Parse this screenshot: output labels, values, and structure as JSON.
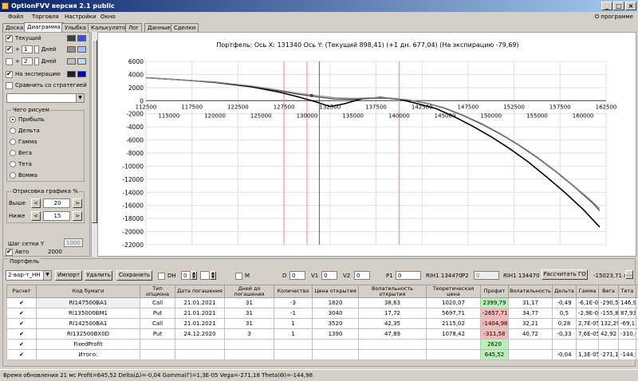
{
  "window": {
    "title": "OptionFVV версия 2.1 public"
  },
  "menu": {
    "items": [
      "Файл",
      "Торговля",
      "Настройки",
      "Окно"
    ],
    "about": "О программе"
  },
  "tabs": [
    "Доска",
    "Диаграмма",
    "Улыбка",
    "Калькулятор",
    "Лог",
    "Данные",
    "Сделки"
  ],
  "active_tab": "Диаграмма",
  "left": {
    "current_label": "Текущий",
    "plus": "+",
    "days_label": "Дней",
    "days1": "1",
    "days2": "2",
    "expiry_label": "На экспирацию",
    "compare_label": "Сравнить со стратегией",
    "what_title": "Чего рисуем",
    "radios": [
      "Прибыль",
      "Дельта",
      "Гамма",
      "Вега",
      "Тета",
      "Вомма"
    ],
    "render_title": "Отрисовка графика %",
    "above_label": "Выше",
    "above_value": "20",
    "below_label": "Ниже",
    "below_value": "15",
    "grid_step_label": "Шаг сетки Y",
    "grid_step_value": "1000",
    "auto_label": "Авто",
    "auto_value": "2000",
    "spin_left": "<",
    "spin_right": ">",
    "swatch_colors": [
      "#404040",
      "#3050ff",
      "#909090",
      "#a0c0ff",
      "#c0c0c0",
      "#c0d8ff",
      "#202020",
      "#0000cc"
    ]
  },
  "chart": {
    "header": "Портфель: Ось X: 131340 Ось Y:  (Текущий 898,41)  (+1 дн. 677,04)  (На экспирацию -79,69)"
  },
  "chart_data": {
    "type": "line",
    "ylim": [
      -22000,
      6000
    ],
    "yticks": [
      6000,
      4000,
      2000,
      0,
      -2000,
      -4000,
      -6000,
      -8000,
      -10000,
      -12000,
      -14000,
      -16000,
      -18000,
      -20000,
      -22000
    ],
    "xlim": [
      112500,
      162500
    ],
    "x_top_ticks": [
      112500,
      117500,
      122500,
      127500,
      132500,
      137500,
      142500,
      147500,
      152500,
      157500,
      162500
    ],
    "x_bottom_ticks": [
      115000,
      120000,
      125000,
      130000,
      135000,
      140000,
      145000,
      150000,
      155000,
      160000
    ],
    "cursor_x": 131340,
    "red_lines": [
      127500,
      130000,
      140000
    ],
    "marker": {
      "x": 130500,
      "y": 780
    },
    "grid": true,
    "series": [
      {
        "color": "#000000",
        "x": [
          112500,
          116000,
          120000,
          124000,
          127000,
          129000,
          131000,
          132500,
          134000,
          136000,
          138000,
          140000,
          142000,
          144000,
          146000,
          148000,
          150000,
          152000,
          154000,
          156000,
          158000,
          160000,
          161800
        ],
        "y": [
          3500,
          3200,
          2800,
          2100,
          1300,
          600,
          -200,
          -900,
          -500,
          300,
          500,
          220,
          -450,
          -1200,
          -2450,
          -3900,
          -5500,
          -7300,
          -9300,
          -11600,
          -14000,
          -16600,
          -19300
        ]
      },
      {
        "color": "#404040",
        "x": [
          112500,
          116000,
          120000,
          124000,
          127000,
          129000,
          131000,
          133000,
          135000,
          137000,
          139000,
          141000,
          143000,
          145000,
          147000,
          149000,
          151000,
          153000,
          155000,
          157000,
          159000,
          161000,
          161800
        ],
        "y": [
          3500,
          3200,
          2850,
          2200,
          1500,
          1000,
          600,
          250,
          200,
          350,
          350,
          100,
          -400,
          -1200,
          -2300,
          -3600,
          -5100,
          -6800,
          -8700,
          -10800,
          -13100,
          -15600,
          -16800
        ]
      },
      {
        "color": "#909090",
        "x": [
          112500,
          116000,
          120000,
          124000,
          127000,
          129000,
          131000,
          133000,
          135000,
          137000,
          139000,
          141000,
          143000,
          145000,
          147000,
          149000,
          151000,
          153000,
          155000,
          157000,
          159000,
          161000,
          161800
        ],
        "y": [
          3500,
          3200,
          2850,
          2250,
          1600,
          1150,
          800,
          450,
          350,
          450,
          420,
          150,
          -350,
          -1100,
          -2200,
          -3500,
          -5000,
          -6700,
          -8600,
          -10700,
          -13000,
          -15400,
          -16500
        ]
      }
    ]
  },
  "portfolio": {
    "title": "Портфель",
    "selector": "2-вар-т_НН",
    "import_btn": "Импорт",
    "delete_btn": "Удалить",
    "save_btn": "Сохранить",
    "dh_label": "DH",
    "dh_value": "0",
    "m_label": "M",
    "d_label": "D",
    "d_value": "0",
    "v1_label": "V1",
    "v1_value": "0",
    "v2_label": "V2",
    "v2_value": "0",
    "p1_label": "P1",
    "p1_value": "0",
    "rih1_a": "RIH1 134470",
    "p2_label": "P2",
    "p2_value": "0",
    "rih1_b": "RIH1 134470",
    "calc_btn": "Рассчитать ГО",
    "go_value": "-15023,71 п.",
    "go_btn": "...",
    "columns": [
      "Расчет",
      "Код бумаги",
      "Тип опциона",
      "Дата погашения",
      "Дней до погашения",
      "Количество",
      "Цена открытия",
      "Волатильность открытия",
      "Теоретическая цена",
      "Профит",
      "Волатильность",
      "Дельта",
      "Гамма",
      "Вега",
      "Тета",
      "✕"
    ],
    "rows": [
      [
        "✔",
        "RI147500BA1",
        "Call",
        "21.01.2021",
        "31",
        "-3",
        "1820",
        "38,63",
        "1020,07",
        "2399,79",
        "31,17",
        "-0,49",
        "-6,1E-05",
        "-290,51",
        "146,9",
        "✕"
      ],
      [
        "✔",
        "RI135000BM1",
        "Put",
        "21.01.2021",
        "31",
        "-1",
        "3040",
        "17,72",
        "5697,71",
        "-2657,71",
        "34,77",
        "0,5",
        "-2,9E-05",
        "-155,88",
        "87,93",
        "✕"
      ],
      [
        "✔",
        "RI142500BA1",
        "Call",
        "21.01.2021",
        "31",
        "1",
        "3520",
        "42,35",
        "2115,02",
        "-1404,98",
        "32,21",
        "0,28",
        "2,7E-05",
        "132,29",
        "-69,13",
        "✕"
      ],
      [
        "✔",
        "RI132500BX0D",
        "Put",
        "24.12.2020",
        "3",
        "1",
        "1390",
        "47,89",
        "1078,42",
        "-311,58",
        "40,72",
        "-0,33",
        "7,6E-05",
        "42,92",
        "-310,68",
        "✕"
      ],
      [
        "✔",
        "FixedProfit",
        "",
        "",
        "",
        "",
        "",
        "",
        "",
        "2620",
        "",
        "",
        "",
        "",
        "",
        "✕"
      ],
      [
        "✔",
        "Итого:",
        "",
        "",
        "",
        "",
        "",
        "",
        "",
        "645,52",
        "",
        "-0,04",
        "1,3E-05",
        "-271,18",
        "-144,98",
        "✕"
      ]
    ]
  },
  "status": "Время обновления 21 мс  Profit=645,52 Delta(Δ)=-0,04 Gamma(Γ)=1,3E-05 Vega=-271,18 Theta(Θ)=-144,98"
}
